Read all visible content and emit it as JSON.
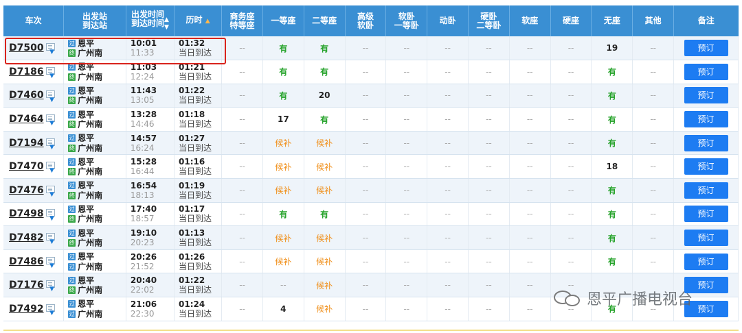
{
  "headers": {
    "train": "车次",
    "stations": "出发站\n到达站",
    "times": "出发时间\n到达时间",
    "times_sort": "▲\n▼",
    "duration": "历时",
    "duration_sort": "▲",
    "business": "商务座\n特等座",
    "first": "一等座",
    "second": "二等座",
    "deluxe_soft": "高级\n软卧",
    "soft_first": "软卧\n一等卧",
    "moving_sleeper": "动卧",
    "hard_second": "硬卧\n二等卧",
    "soft_seat": "软座",
    "hard_seat": "硬座",
    "no_seat": "无座",
    "other": "其他",
    "remark": "备注"
  },
  "book_label": "预订",
  "watermark_text": "恩平广播电视台",
  "rows": [
    {
      "train": "D7500",
      "from": "恩平",
      "from_tag": "过",
      "to": "广州南",
      "to_tag": "终",
      "dep": "10:01",
      "arr": "11:33",
      "dur": "01:32",
      "note": "当日到达",
      "business": "--",
      "first": "有",
      "second": "有",
      "deluxe": "--",
      "soft1": "--",
      "moving": "--",
      "hard2": "--",
      "softseat": "--",
      "hardseat": "--",
      "noseat": "19",
      "other": "--"
    },
    {
      "train": "D7186",
      "from": "恩平",
      "from_tag": "过",
      "to": "广州南",
      "to_tag": "终",
      "dep": "11:03",
      "arr": "12:24",
      "dur": "01:21",
      "note": "当日到达",
      "business": "--",
      "first": "有",
      "second": "有",
      "deluxe": "--",
      "soft1": "--",
      "moving": "--",
      "hard2": "--",
      "softseat": "--",
      "hardseat": "--",
      "noseat": "有",
      "other": "--"
    },
    {
      "train": "D7460",
      "from": "恩平",
      "from_tag": "过",
      "to": "广州南",
      "to_tag": "终",
      "dep": "11:43",
      "arr": "13:05",
      "dur": "01:22",
      "note": "当日到达",
      "business": "--",
      "first": "有",
      "second": "20",
      "deluxe": "--",
      "soft1": "--",
      "moving": "--",
      "hard2": "--",
      "softseat": "--",
      "hardseat": "--",
      "noseat": "有",
      "other": "--"
    },
    {
      "train": "D7464",
      "from": "恩平",
      "from_tag": "过",
      "to": "广州南",
      "to_tag": "终",
      "dep": "13:28",
      "arr": "14:46",
      "dur": "01:18",
      "note": "当日到达",
      "business": "--",
      "first": "17",
      "second": "有",
      "deluxe": "--",
      "soft1": "--",
      "moving": "--",
      "hard2": "--",
      "softseat": "--",
      "hardseat": "--",
      "noseat": "有",
      "other": "--"
    },
    {
      "train": "D7194",
      "from": "恩平",
      "from_tag": "过",
      "to": "广州南",
      "to_tag": "终",
      "dep": "14:57",
      "arr": "16:24",
      "dur": "01:27",
      "note": "当日到达",
      "business": "--",
      "first": "候补",
      "second": "候补",
      "deluxe": "--",
      "soft1": "--",
      "moving": "--",
      "hard2": "--",
      "softseat": "--",
      "hardseat": "--",
      "noseat": "有",
      "other": "--"
    },
    {
      "train": "D7470",
      "from": "恩平",
      "from_tag": "过",
      "to": "广州南",
      "to_tag": "终",
      "dep": "15:28",
      "arr": "16:44",
      "dur": "01:16",
      "note": "当日到达",
      "business": "--",
      "first": "候补",
      "second": "候补",
      "deluxe": "--",
      "soft1": "--",
      "moving": "--",
      "hard2": "--",
      "softseat": "--",
      "hardseat": "--",
      "noseat": "18",
      "other": "--"
    },
    {
      "train": "D7476",
      "from": "恩平",
      "from_tag": "过",
      "to": "广州南",
      "to_tag": "终",
      "dep": "16:54",
      "arr": "18:13",
      "dur": "01:19",
      "note": "当日到达",
      "business": "--",
      "first": "候补",
      "second": "候补",
      "deluxe": "--",
      "soft1": "--",
      "moving": "--",
      "hard2": "--",
      "softseat": "--",
      "hardseat": "--",
      "noseat": "有",
      "other": "--"
    },
    {
      "train": "D7498",
      "from": "恩平",
      "from_tag": "过",
      "to": "广州南",
      "to_tag": "终",
      "dep": "17:40",
      "arr": "18:57",
      "dur": "01:17",
      "note": "当日到达",
      "business": "--",
      "first": "有",
      "second": "有",
      "deluxe": "--",
      "soft1": "--",
      "moving": "--",
      "hard2": "--",
      "softseat": "--",
      "hardseat": "--",
      "noseat": "有",
      "other": "--"
    },
    {
      "train": "D7482",
      "from": "恩平",
      "from_tag": "过",
      "to": "广州南",
      "to_tag": "终",
      "dep": "19:10",
      "arr": "20:23",
      "dur": "01:13",
      "note": "当日到达",
      "business": "--",
      "first": "候补",
      "second": "候补",
      "deluxe": "--",
      "soft1": "--",
      "moving": "--",
      "hard2": "--",
      "softseat": "--",
      "hardseat": "--",
      "noseat": "有",
      "other": "--"
    },
    {
      "train": "D7486",
      "from": "恩平",
      "from_tag": "过",
      "to": "广州南",
      "to_tag": "过",
      "dep": "20:26",
      "arr": "21:52",
      "dur": "01:26",
      "note": "当日到达",
      "business": "--",
      "first": "候补",
      "second": "候补",
      "deluxe": "--",
      "soft1": "--",
      "moving": "--",
      "hard2": "--",
      "softseat": "--",
      "hardseat": "--",
      "noseat": "有",
      "other": "--"
    },
    {
      "train": "D7176",
      "from": "恩平",
      "from_tag": "过",
      "to": "广州南",
      "to_tag": "终",
      "dep": "20:40",
      "arr": "22:02",
      "dur": "01:22",
      "note": "当日到达",
      "business": "--",
      "first": "--",
      "second": "候补",
      "deluxe": "--",
      "soft1": "--",
      "moving": "--",
      "hard2": "--",
      "softseat": "--",
      "hardseat": "--",
      "noseat": "",
      "other": ""
    },
    {
      "train": "D7492",
      "from": "恩平",
      "from_tag": "过",
      "to": "广州南",
      "to_tag": "过",
      "dep": "21:06",
      "arr": "22:30",
      "dur": "01:24",
      "note": "当日到达",
      "business": "--",
      "first": "4",
      "second": "候补",
      "deluxe": "--",
      "soft1": "--",
      "moving": "--",
      "hard2": "--",
      "softseat": "--",
      "hardseat": "--",
      "noseat": "有",
      "other": "--"
    }
  ]
}
